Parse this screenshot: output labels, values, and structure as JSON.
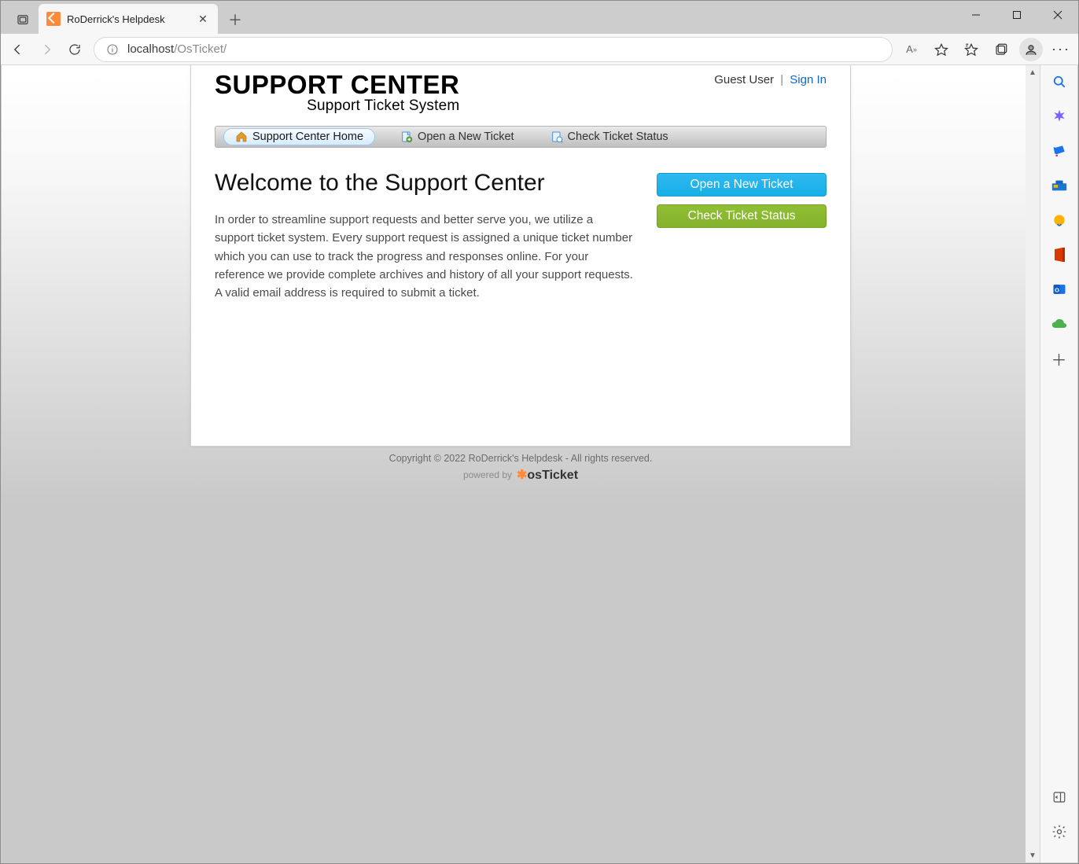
{
  "browser": {
    "tab_title": "RoDerrick's Helpdesk",
    "url_host": "localhost",
    "url_path": "/OsTicket/"
  },
  "header": {
    "logo_main": "SUPPORT CENTER",
    "logo_sub": "Support Ticket System",
    "user_label": "Guest User",
    "separator": "|",
    "signin": "Sign In"
  },
  "nav": {
    "home": "Support Center Home",
    "open": "Open a New Ticket",
    "status": "Check Ticket Status"
  },
  "main": {
    "title": "Welcome to the Support Center",
    "intro": "In order to streamline support requests and better serve you, we utilize a support ticket system. Every support request is assigned a unique ticket number which you can use to track the progress and responses online. For your reference we provide complete archives and history of all your support requests. A valid email address is required to submit a ticket."
  },
  "cta": {
    "open": "Open a New Ticket",
    "status": "Check Ticket Status"
  },
  "footer": {
    "copyright": "Copyright © 2022 RoDerrick's Helpdesk - All rights reserved.",
    "powered": "powered by"
  }
}
